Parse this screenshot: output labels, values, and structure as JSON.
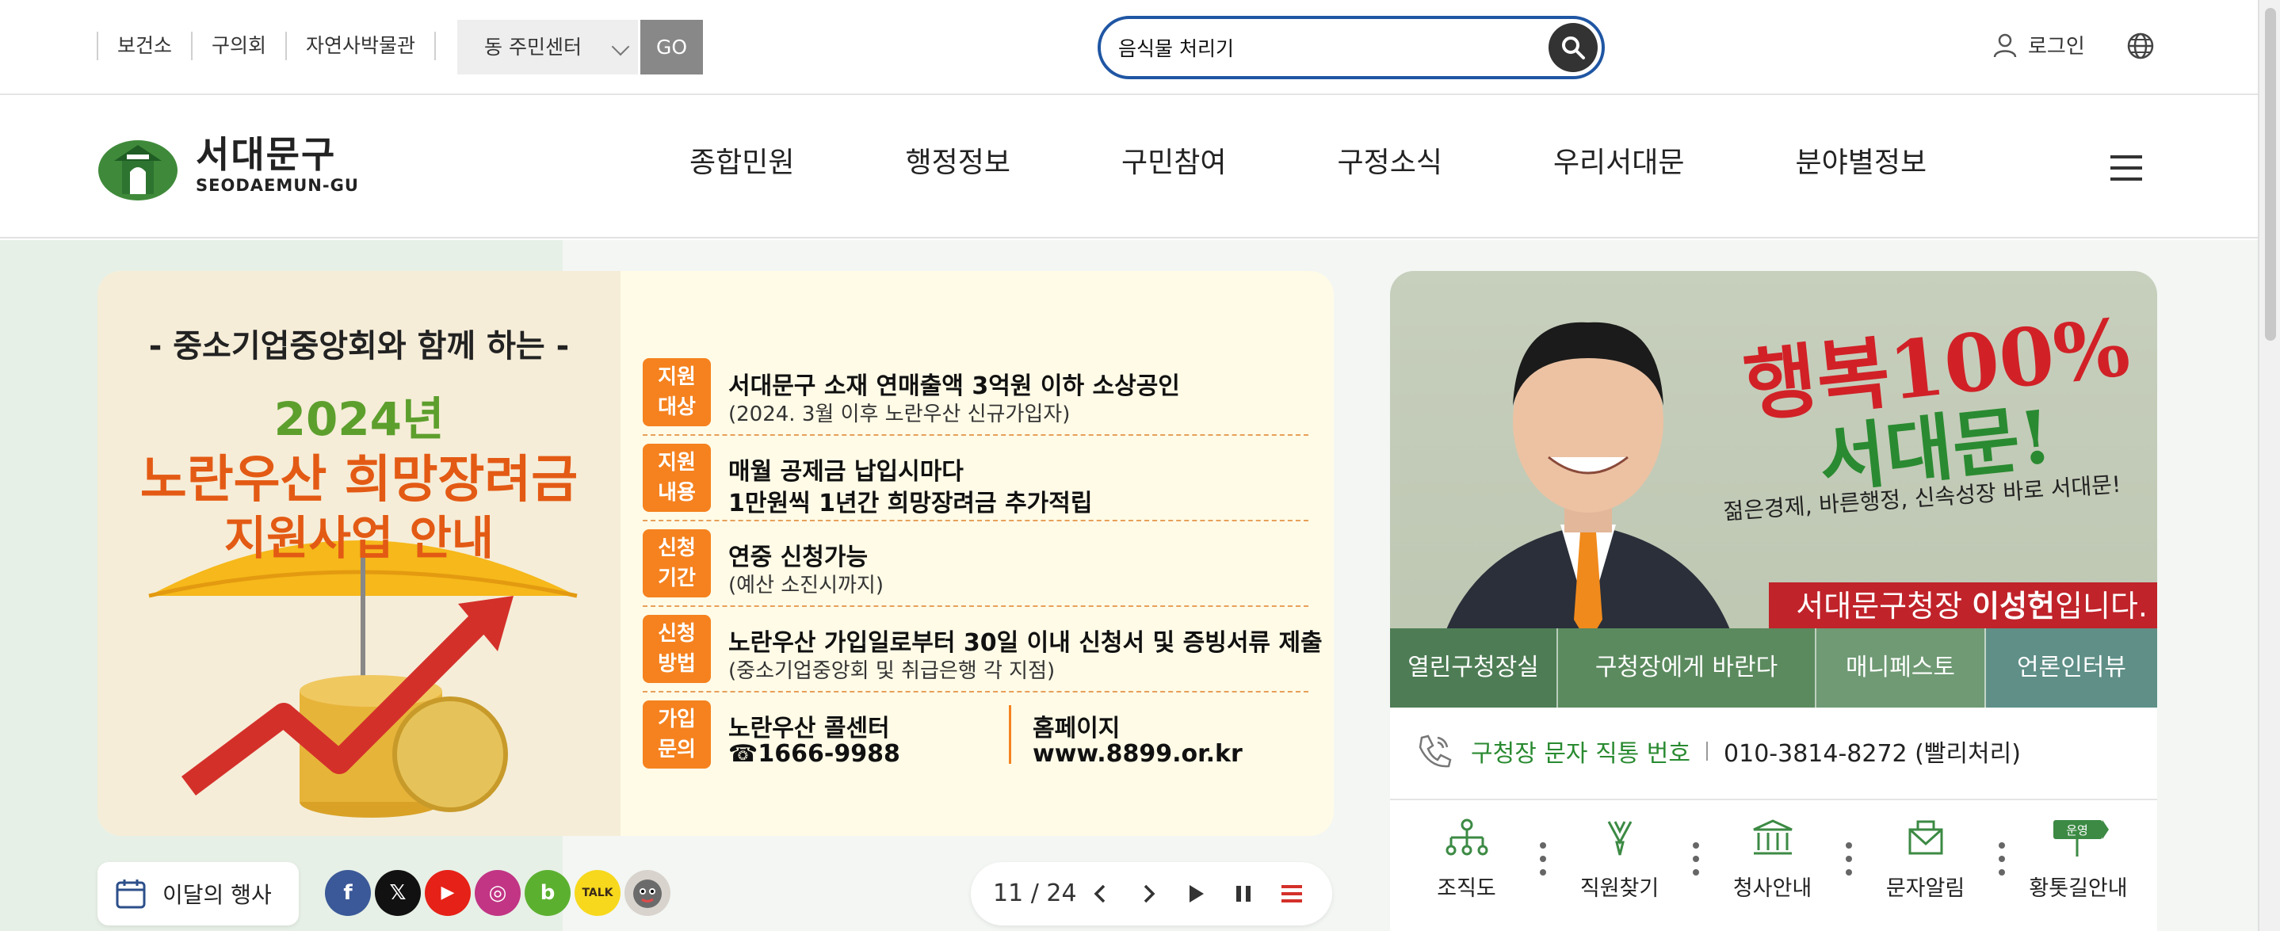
{
  "top_links": [
    "보건소",
    "구의회",
    "자연사박물관"
  ],
  "dong_select": {
    "value": "동 주민센터",
    "go": "GO"
  },
  "search": {
    "value": "음식물 처리기"
  },
  "login": "로그인",
  "logo": {
    "korean": "서대문구",
    "english": "SEODAEMUN-GU"
  },
  "menu": [
    "종합민원",
    "행정정보",
    "구민참여",
    "구정소식",
    "우리서대문",
    "분야별정보"
  ],
  "banner": {
    "subtitle": "- 중소기업중앙회와 함께 하는 -",
    "year": "2024년",
    "title1": "노란우산 희망장려금",
    "title2": "지원사업 안내",
    "rows": [
      {
        "tag": "지원\n대상",
        "line1": "서대문구 소재 연매출액 3억원 이하 소상공인",
        "line2": "(2024. 3월 이후 노란우산 신규가입자)"
      },
      {
        "tag": "지원\n내용",
        "line1": "매월 공제금 납입시마다",
        "line2b": "1만원씩 1년간 희망장려금 추가적립"
      },
      {
        "tag": "신청\n기간",
        "line1": "연중 신청가능",
        "line2": "(예산 소진시까지)"
      },
      {
        "tag": "신청\n방법",
        "line1": "노란우산 가입일로부터 30일 이내 신청서 및 증빙서류 제출",
        "line2": "(중소기업중앙회 및 취급은행 각 지점)"
      }
    ],
    "contact": {
      "tag": "가입\n문의",
      "callcenter": "노란우산 콜센터",
      "phone": "☎1666-9988",
      "hp_label": "홈페이지",
      "hp_url": "www.8899.or.kr"
    }
  },
  "event_button": "이달의 행사",
  "social": [
    {
      "name": "facebook",
      "glyph": "f",
      "color": "#3b5998"
    },
    {
      "name": "x",
      "glyph": "𝕏",
      "color": "#111111"
    },
    {
      "name": "youtube",
      "glyph": "▶",
      "color": "#e62117"
    },
    {
      "name": "instagram",
      "glyph": "◎",
      "color": "#c13584"
    },
    {
      "name": "blog",
      "glyph": "b",
      "color": "#5cb030"
    },
    {
      "name": "kakaotalk",
      "glyph": "TALK",
      "color": "#f7d81c"
    },
    {
      "name": "mascot",
      "glyph": "",
      "color": "#6b6b6b"
    }
  ],
  "pager": {
    "current": "11",
    "total": "24",
    "display": "11 / 24"
  },
  "mayor": {
    "slogan1": "행복100%",
    "slogan2": "서대문!",
    "slogan3": "젊은경제, 바른행정, 신속성장 바로 서대문!",
    "name_prefix": "서대문구청장 ",
    "name": "이성헌",
    "name_suffix": "입니다."
  },
  "mayor_tabs": [
    {
      "label": "열린구청장실",
      "color": "#4e7d55"
    },
    {
      "label": "구청장에게 바란다",
      "color": "#5b8a5e"
    },
    {
      "label": "매니페스토",
      "color": "#6f9a74"
    },
    {
      "label": "언론인터뷰",
      "color": "#5f8f87"
    }
  ],
  "hotline": {
    "label": "구청장 문자 직통 번호",
    "number": "010-3814-8272 (빨리처리)"
  },
  "quick_links": [
    {
      "label": "조직도",
      "icon": "org-chart-icon"
    },
    {
      "label": "직원찾기",
      "icon": "staff-search-icon"
    },
    {
      "label": "청사안내",
      "icon": "building-icon"
    },
    {
      "label": "문자알림",
      "icon": "message-icon"
    },
    {
      "label": "황톳길안내",
      "icon": "signpost-icon",
      "badge": "운영"
    }
  ]
}
